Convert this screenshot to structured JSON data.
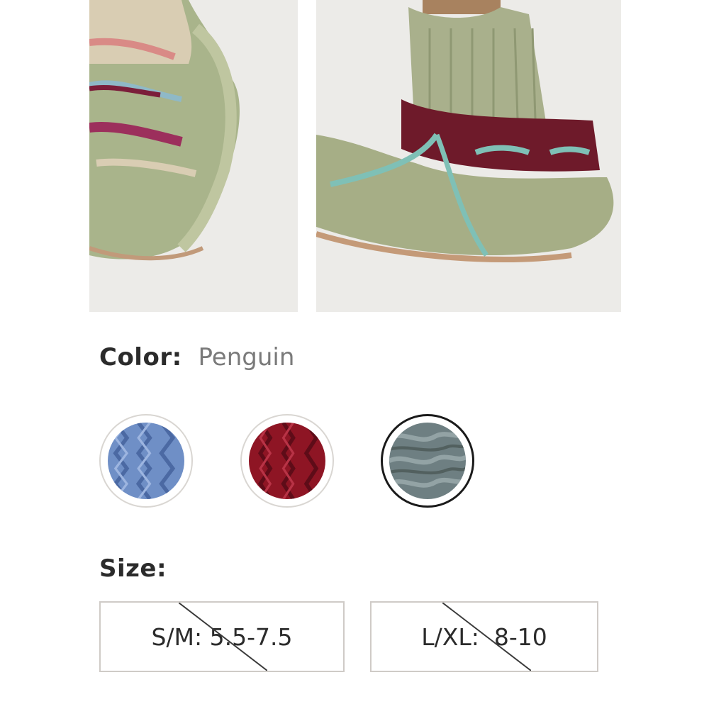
{
  "product": {
    "color_label": "Color:",
    "color_value": "Penguin",
    "size_label": "Size:"
  },
  "swatches": [
    {
      "name": "blue",
      "hex": "#6f8fc6",
      "selected": false
    },
    {
      "name": "red",
      "hex": "#8e1524",
      "selected": false
    },
    {
      "name": "grey",
      "hex": "#6e7f82",
      "selected": true
    }
  ],
  "sizes": [
    {
      "label": "S/M: 5.5-7.5",
      "available": false
    },
    {
      "label": "L/XL:  8-10",
      "available": false
    }
  ],
  "colors": {
    "text": "#2b2b2b",
    "muted": "#7a7a7a",
    "border": "#cfcbc7",
    "selected_border": "#1a1a1a"
  }
}
